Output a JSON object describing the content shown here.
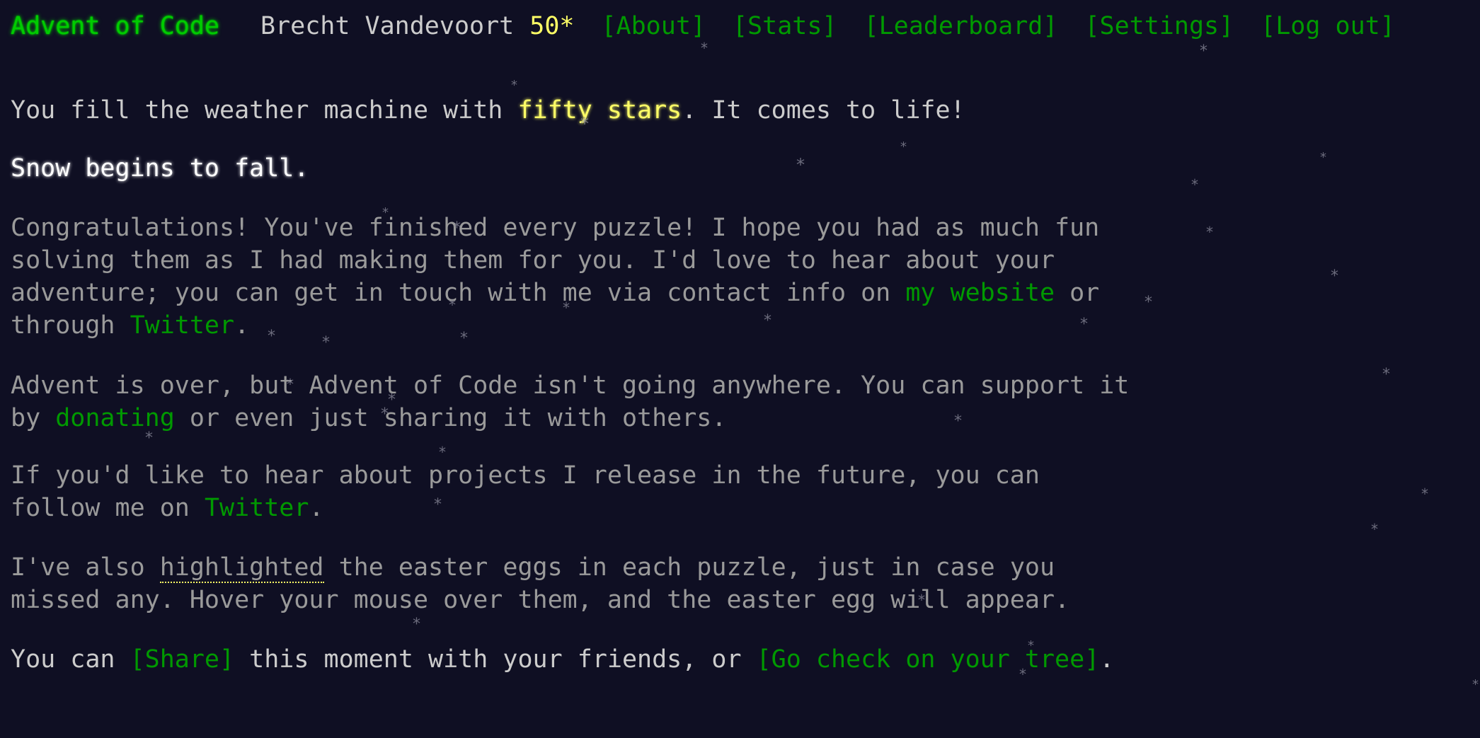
{
  "header": {
    "title": "Advent of Code",
    "user": "Brecht Vandevoort",
    "star_count": "50*",
    "nav": [
      "[About]",
      "[Stats]",
      "[Leaderboard]",
      "[Settings]",
      "[Log out]"
    ]
  },
  "content": {
    "p1": {
      "before": "You fill the weather machine with ",
      "highlight": "fifty stars",
      "after": ". It comes to life!"
    },
    "p2": "Snow begins to fall.",
    "p3": {
      "line1": "Congratulations! You've finished every puzzle! I hope you had as much fun",
      "line2": "solving them as I had making them for you. I'd love to hear about your",
      "line3_before": "adventure; you can get in touch with me via contact info on ",
      "website_link": "my website",
      "line3_after": " or",
      "line4_before": "through ",
      "twitter_link": "Twitter",
      "line4_after": "."
    },
    "p4": {
      "line1": "Advent is over, but Advent of Code isn't going anywhere. You can support it",
      "line2_before": "by ",
      "donating_link": "donating",
      "line2_after": " or even just sharing it with others."
    },
    "p5": {
      "line1": "If you'd like to hear about projects I release in the future, you can",
      "line2_before": "follow me on ",
      "twitter_link": "Twitter",
      "line2_after": "."
    },
    "p6": {
      "line1_before": "I've also ",
      "highlighted": "highlighted",
      "line1_after": " the easter eggs in each puzzle, just in case you",
      "line2": "missed any. Hover your mouse over them, and the easter egg will appear."
    },
    "p7": {
      "before": "You can ",
      "share_link": "[Share]",
      "middle": " this moment with your friends, or ",
      "tree_link": "[Go check on your tree]",
      "after": "."
    }
  },
  "snowflake_glyph": "*"
}
